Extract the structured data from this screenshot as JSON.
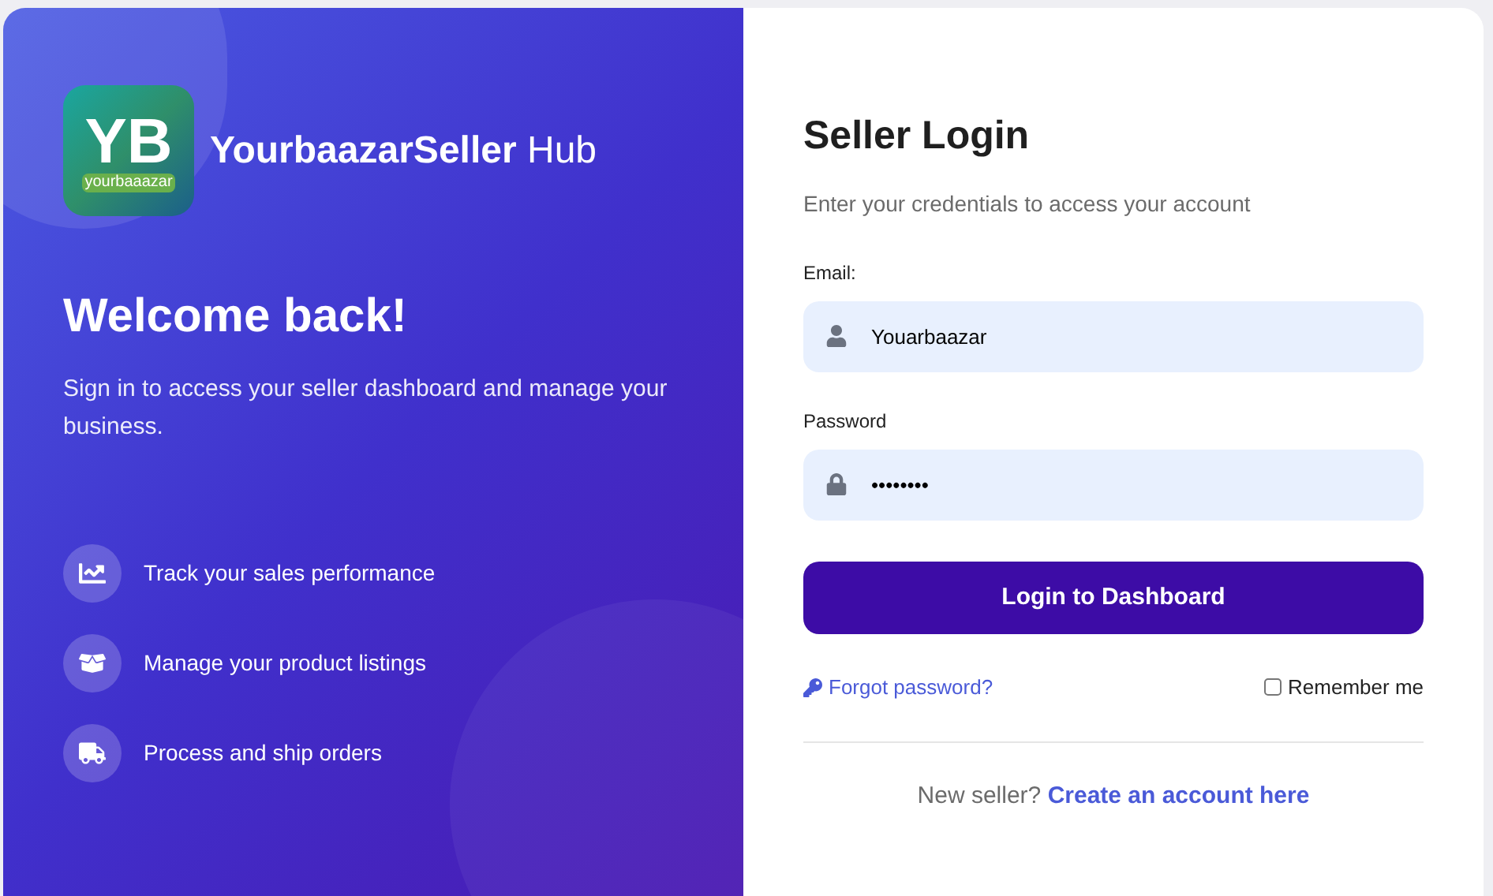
{
  "brand": {
    "logo_letters": "YB",
    "logo_caption": "yourbaaazar",
    "name": "YourbaazarSeller",
    "suffix": "Hub"
  },
  "welcome": {
    "heading": "Welcome back!",
    "text": "Sign in to access your seller dashboard and manage your business."
  },
  "features": [
    {
      "kind": "chart",
      "label": "Track your sales performance"
    },
    {
      "kind": "box",
      "label": "Manage your product listings"
    },
    {
      "kind": "truck",
      "label": "Process and ship orders"
    }
  ],
  "login": {
    "title": "Seller Login",
    "subtitle": "Enter your credentials to access your account",
    "fields": [
      {
        "kind": "user",
        "label": "Email:",
        "value": "Youarbaazar"
      },
      {
        "kind": "lock",
        "label": "Password",
        "value": "••••••••"
      }
    ],
    "submit": "Login to Dashboard",
    "forgot": "Forgot password?",
    "remember": {
      "label": "Remember me",
      "checked": false
    },
    "signup_prompt": "New seller?",
    "signup_link": "Create an account here"
  }
}
